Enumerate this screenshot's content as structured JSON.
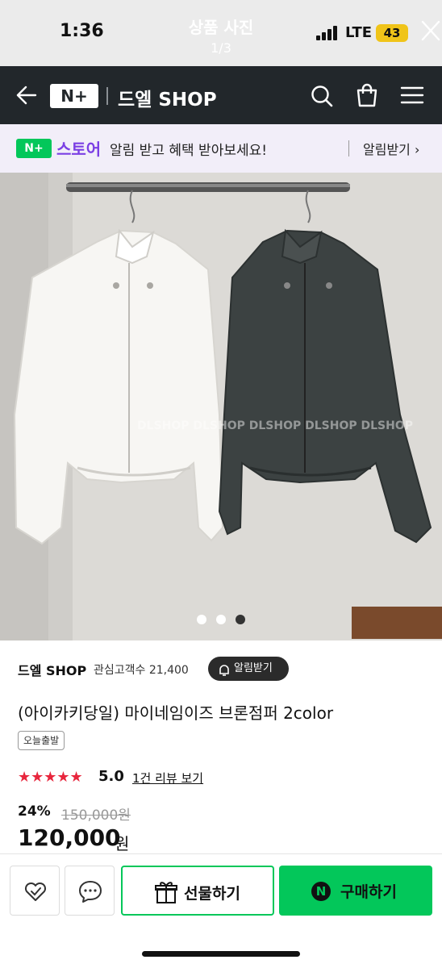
{
  "status_bar": {
    "time": "1:36",
    "network": "LTE",
    "battery": "43"
  },
  "viewer": {
    "title": "상품 사진",
    "counter": "1/3"
  },
  "header": {
    "logo": "N+",
    "shop_name": "드엘 SHOP"
  },
  "promo": {
    "badge": "N+",
    "store_label": "스토어",
    "text": "알림 받고 혜택 받아보세요!",
    "link": "알림받기 ›"
  },
  "gallery": {
    "watermark": "DLSHOP DLSHOP DLSHOP DLSHOP DLSHOP",
    "total": 3,
    "current": 3
  },
  "product": {
    "seller": "드엘 SHOP",
    "followers": "관심고객수 21,400",
    "alarm_button": "알림받기",
    "title": "(아이카키당일) 마이네임이즈 브론점퍼 2color",
    "tag": "오늘출발",
    "stars": "★★★★★",
    "rating": "5.0",
    "review_link": "1건 리뷰 보기",
    "discount": "24%",
    "original_price": "150,000원",
    "price": "120,000",
    "currency": "원"
  },
  "actions": {
    "gift": "선물하기",
    "buy_icon": "N",
    "buy": "구매하기"
  },
  "colors": {
    "naver_green": "#03c75a",
    "header_dark": "#22272b",
    "store_purple": "#7b3fe4",
    "star_red": "#e8263d"
  }
}
